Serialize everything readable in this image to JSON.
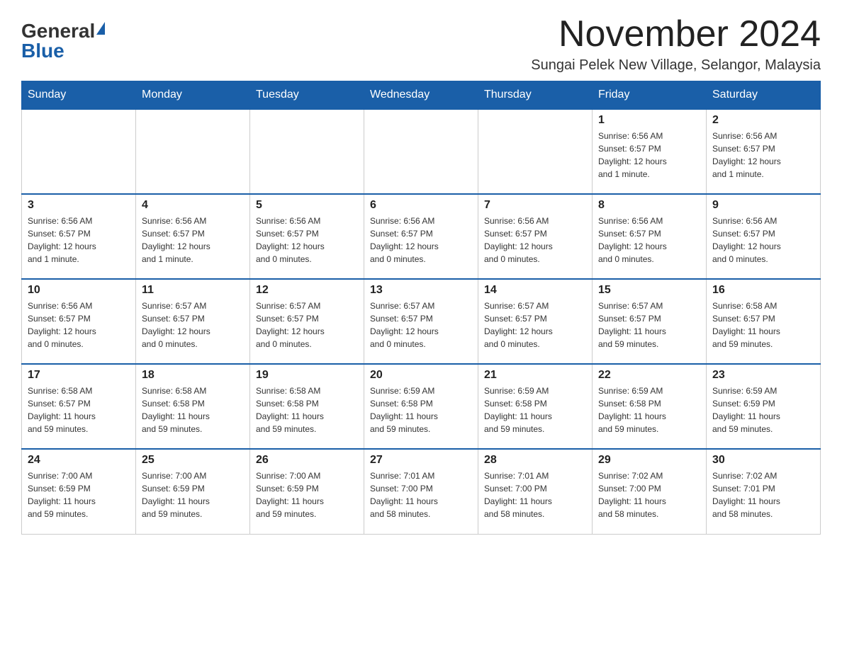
{
  "header": {
    "logo_general": "General",
    "logo_blue": "Blue",
    "month_title": "November 2024",
    "location": "Sungai Pelek New Village, Selangor, Malaysia"
  },
  "days_of_week": [
    "Sunday",
    "Monday",
    "Tuesday",
    "Wednesday",
    "Thursday",
    "Friday",
    "Saturday"
  ],
  "weeks": [
    {
      "days": [
        {
          "num": "",
          "info": ""
        },
        {
          "num": "",
          "info": ""
        },
        {
          "num": "",
          "info": ""
        },
        {
          "num": "",
          "info": ""
        },
        {
          "num": "",
          "info": ""
        },
        {
          "num": "1",
          "info": "Sunrise: 6:56 AM\nSunset: 6:57 PM\nDaylight: 12 hours\nand 1 minute."
        },
        {
          "num": "2",
          "info": "Sunrise: 6:56 AM\nSunset: 6:57 PM\nDaylight: 12 hours\nand 1 minute."
        }
      ]
    },
    {
      "days": [
        {
          "num": "3",
          "info": "Sunrise: 6:56 AM\nSunset: 6:57 PM\nDaylight: 12 hours\nand 1 minute."
        },
        {
          "num": "4",
          "info": "Sunrise: 6:56 AM\nSunset: 6:57 PM\nDaylight: 12 hours\nand 1 minute."
        },
        {
          "num": "5",
          "info": "Sunrise: 6:56 AM\nSunset: 6:57 PM\nDaylight: 12 hours\nand 0 minutes."
        },
        {
          "num": "6",
          "info": "Sunrise: 6:56 AM\nSunset: 6:57 PM\nDaylight: 12 hours\nand 0 minutes."
        },
        {
          "num": "7",
          "info": "Sunrise: 6:56 AM\nSunset: 6:57 PM\nDaylight: 12 hours\nand 0 minutes."
        },
        {
          "num": "8",
          "info": "Sunrise: 6:56 AM\nSunset: 6:57 PM\nDaylight: 12 hours\nand 0 minutes."
        },
        {
          "num": "9",
          "info": "Sunrise: 6:56 AM\nSunset: 6:57 PM\nDaylight: 12 hours\nand 0 minutes."
        }
      ]
    },
    {
      "days": [
        {
          "num": "10",
          "info": "Sunrise: 6:56 AM\nSunset: 6:57 PM\nDaylight: 12 hours\nand 0 minutes."
        },
        {
          "num": "11",
          "info": "Sunrise: 6:57 AM\nSunset: 6:57 PM\nDaylight: 12 hours\nand 0 minutes."
        },
        {
          "num": "12",
          "info": "Sunrise: 6:57 AM\nSunset: 6:57 PM\nDaylight: 12 hours\nand 0 minutes."
        },
        {
          "num": "13",
          "info": "Sunrise: 6:57 AM\nSunset: 6:57 PM\nDaylight: 12 hours\nand 0 minutes."
        },
        {
          "num": "14",
          "info": "Sunrise: 6:57 AM\nSunset: 6:57 PM\nDaylight: 12 hours\nand 0 minutes."
        },
        {
          "num": "15",
          "info": "Sunrise: 6:57 AM\nSunset: 6:57 PM\nDaylight: 11 hours\nand 59 minutes."
        },
        {
          "num": "16",
          "info": "Sunrise: 6:58 AM\nSunset: 6:57 PM\nDaylight: 11 hours\nand 59 minutes."
        }
      ]
    },
    {
      "days": [
        {
          "num": "17",
          "info": "Sunrise: 6:58 AM\nSunset: 6:57 PM\nDaylight: 11 hours\nand 59 minutes."
        },
        {
          "num": "18",
          "info": "Sunrise: 6:58 AM\nSunset: 6:58 PM\nDaylight: 11 hours\nand 59 minutes."
        },
        {
          "num": "19",
          "info": "Sunrise: 6:58 AM\nSunset: 6:58 PM\nDaylight: 11 hours\nand 59 minutes."
        },
        {
          "num": "20",
          "info": "Sunrise: 6:59 AM\nSunset: 6:58 PM\nDaylight: 11 hours\nand 59 minutes."
        },
        {
          "num": "21",
          "info": "Sunrise: 6:59 AM\nSunset: 6:58 PM\nDaylight: 11 hours\nand 59 minutes."
        },
        {
          "num": "22",
          "info": "Sunrise: 6:59 AM\nSunset: 6:58 PM\nDaylight: 11 hours\nand 59 minutes."
        },
        {
          "num": "23",
          "info": "Sunrise: 6:59 AM\nSunset: 6:59 PM\nDaylight: 11 hours\nand 59 minutes."
        }
      ]
    },
    {
      "days": [
        {
          "num": "24",
          "info": "Sunrise: 7:00 AM\nSunset: 6:59 PM\nDaylight: 11 hours\nand 59 minutes."
        },
        {
          "num": "25",
          "info": "Sunrise: 7:00 AM\nSunset: 6:59 PM\nDaylight: 11 hours\nand 59 minutes."
        },
        {
          "num": "26",
          "info": "Sunrise: 7:00 AM\nSunset: 6:59 PM\nDaylight: 11 hours\nand 59 minutes."
        },
        {
          "num": "27",
          "info": "Sunrise: 7:01 AM\nSunset: 7:00 PM\nDaylight: 11 hours\nand 58 minutes."
        },
        {
          "num": "28",
          "info": "Sunrise: 7:01 AM\nSunset: 7:00 PM\nDaylight: 11 hours\nand 58 minutes."
        },
        {
          "num": "29",
          "info": "Sunrise: 7:02 AM\nSunset: 7:00 PM\nDaylight: 11 hours\nand 58 minutes."
        },
        {
          "num": "30",
          "info": "Sunrise: 7:02 AM\nSunset: 7:01 PM\nDaylight: 11 hours\nand 58 minutes."
        }
      ]
    }
  ]
}
